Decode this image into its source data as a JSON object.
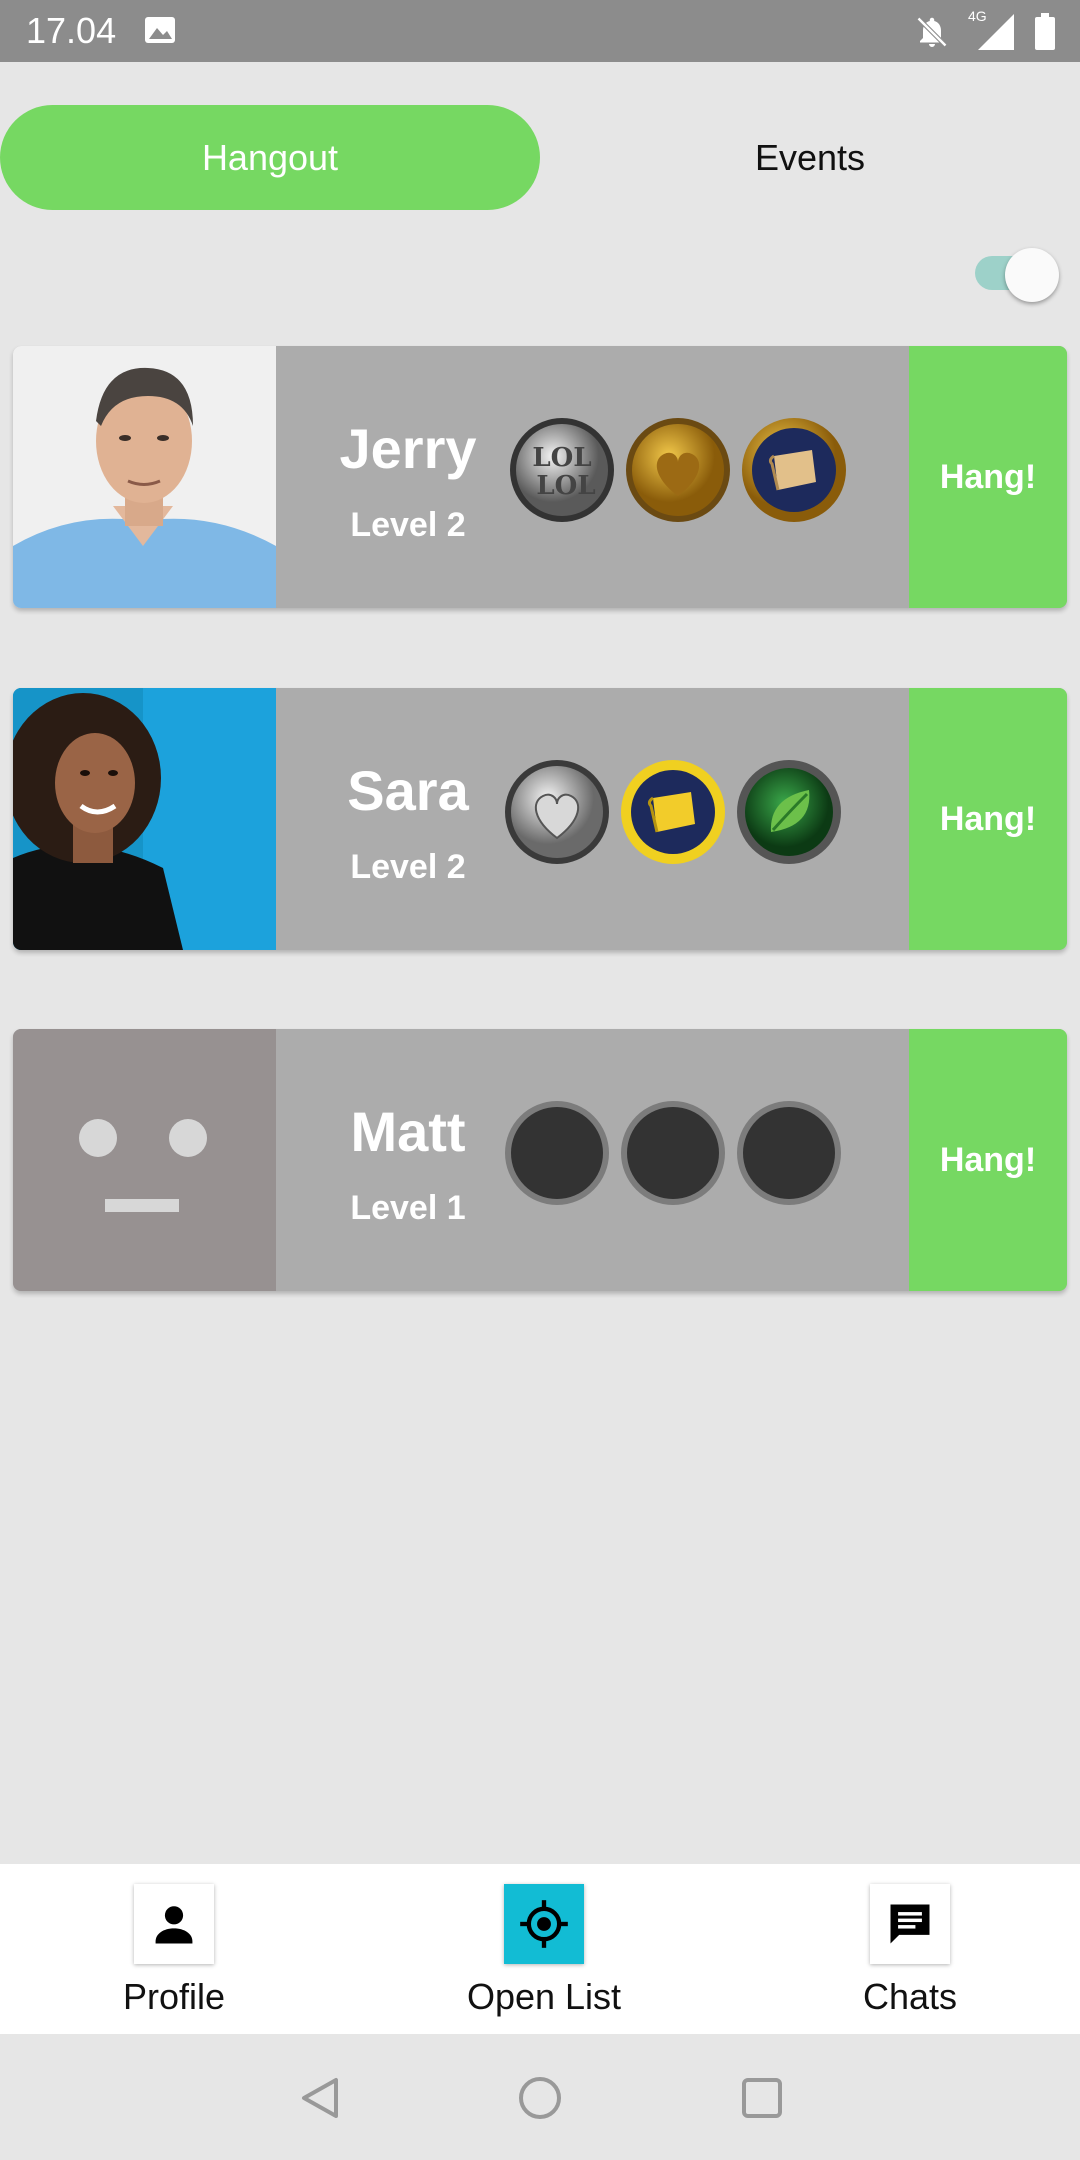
{
  "status_bar": {
    "time": "17.04",
    "network": "4G",
    "icons": [
      "image-icon",
      "bell-off-icon",
      "signal-icon",
      "battery-icon"
    ]
  },
  "tabs": {
    "active": "Hangout",
    "items": [
      {
        "label": "Hangout"
      },
      {
        "label": "Events"
      }
    ]
  },
  "toggle": {
    "on": true
  },
  "colors": {
    "accent_green": "#76d862",
    "card_gray": "#acacac",
    "open_list_blue": "#12bcd4"
  },
  "users": [
    {
      "name": "Jerry",
      "level": "Level 2",
      "hang_label": "Hang!",
      "avatar": "photo-man",
      "badges": [
        "lol-silver-badge",
        "heart-gold-badge",
        "scroll-blue-gold-badge"
      ]
    },
    {
      "name": "Sara",
      "level": "Level 2",
      "hang_label": "Hang!",
      "avatar": "photo-woman",
      "badges": [
        "heart-silver-badge",
        "scroll-blue-yellow-badge",
        "leaf-green-badge"
      ]
    },
    {
      "name": "Matt",
      "level": "Level 1",
      "hang_label": "Hang!",
      "avatar": "placeholder-face",
      "badges": [
        "empty-badge",
        "empty-badge",
        "empty-badge"
      ]
    }
  ],
  "bottom_nav": {
    "profile": "Profile",
    "open_list": "Open List",
    "chats": "Chats"
  },
  "system_nav": [
    "back-icon",
    "home-icon",
    "recents-icon"
  ]
}
